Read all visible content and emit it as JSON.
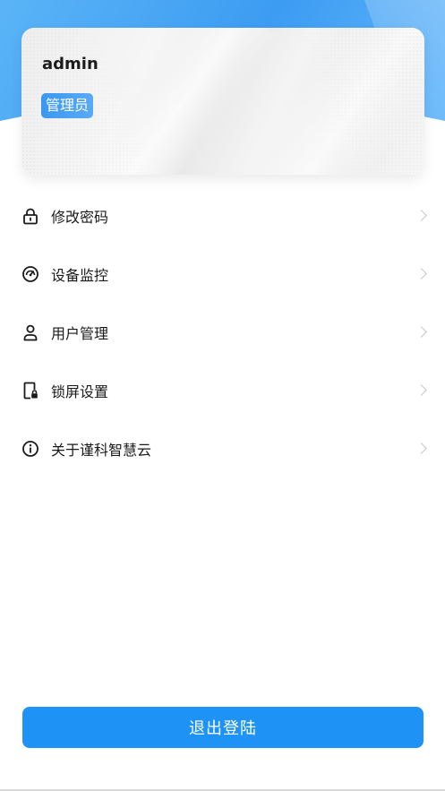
{
  "profile": {
    "username": "admin",
    "role": "管理员"
  },
  "menu": {
    "items": [
      {
        "label": "修改密码",
        "icon": "lock-icon"
      },
      {
        "label": "设备监控",
        "icon": "gauge-icon"
      },
      {
        "label": "用户管理",
        "icon": "user-icon"
      },
      {
        "label": "锁屏设置",
        "icon": "phone-lock-icon"
      },
      {
        "label": "关于谨科智慧云",
        "icon": "info-icon"
      }
    ]
  },
  "actions": {
    "logout_label": "退出登陆"
  },
  "colors": {
    "primary": "#1f93f5",
    "header": "#3c9cf2"
  }
}
